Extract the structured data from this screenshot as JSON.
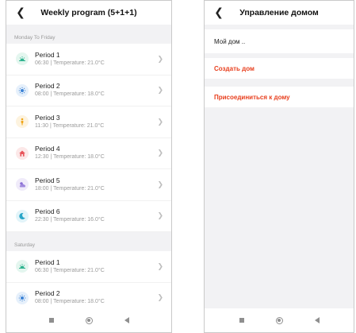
{
  "left_screen": {
    "title": "Weekly program (5+1+1)",
    "back_icon": "chevron-left-icon",
    "sections": [
      {
        "header": "Monday To Friday",
        "periods": [
          {
            "name": "Period 1",
            "detail": "06:30  |  Temperature: 21.0°C",
            "icon": "sunrise-icon",
            "icon_color": "#2fb38f",
            "icon_bg": "#e4f6ef"
          },
          {
            "name": "Period 2",
            "detail": "08:00  |  Temperature: 18.0°C",
            "icon": "sun-icon",
            "icon_color": "#3b82d6",
            "icon_bg": "#e6f0fb"
          },
          {
            "name": "Period 3",
            "detail": "11:30  |  Temperature: 21.0°C",
            "icon": "person-icon",
            "icon_color": "#f0a71a",
            "icon_bg": "#fdf3df"
          },
          {
            "name": "Period 4",
            "detail": "12:30  |  Temperature: 18.0°C",
            "icon": "home-icon",
            "icon_color": "#e8545a",
            "icon_bg": "#fce8e8"
          },
          {
            "name": "Period 5",
            "detail": "18:00  |  Temperature: 21.0°C",
            "icon": "sunset-icon",
            "icon_color": "#8b6fd6",
            "icon_bg": "#f0ebfa"
          },
          {
            "name": "Period 6",
            "detail": "22:30  |  Temperature: 16.0°C",
            "icon": "moon-icon",
            "icon_color": "#2aa6c8",
            "icon_bg": "#e2f4f9"
          }
        ]
      },
      {
        "header": "Saturday",
        "periods": [
          {
            "name": "Period 1",
            "detail": "06:30  |  Temperature: 21.0°C",
            "icon": "sunrise-icon",
            "icon_color": "#2fb38f",
            "icon_bg": "#e4f6ef"
          },
          {
            "name": "Period 2",
            "detail": "08:00  |  Temperature: 18.0°C",
            "icon": "sun-icon",
            "icon_color": "#3b82d6",
            "icon_bg": "#e6f0fb"
          }
        ]
      }
    ]
  },
  "right_screen": {
    "title": "Управление домом",
    "back_icon": "chevron-left-icon",
    "home_name": "Мой дом ..",
    "create_home": "Создать дом",
    "join_home": "Присоединиться к дому",
    "accent_color": "#e8401f"
  },
  "android_nav": {
    "icons": [
      "recent-apps-icon",
      "home-icon",
      "back-icon"
    ]
  }
}
